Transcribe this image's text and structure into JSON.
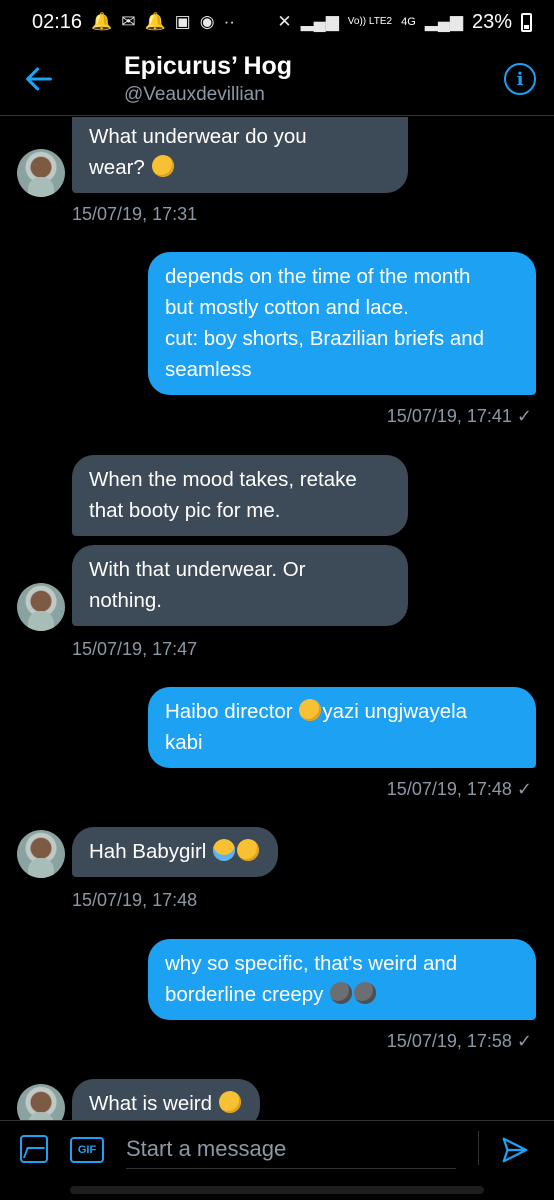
{
  "status_bar": {
    "time": "02:16",
    "left_icons": [
      "bell-icon",
      "gmail-icon",
      "bell-icon",
      "image-icon",
      "wifi-icon",
      "more-icon"
    ],
    "network_label": "Vo)) LTE2",
    "network_type": "4G",
    "battery": "23%"
  },
  "header": {
    "title": "Epicurus’ Hog",
    "handle": "@Veauxdevillian"
  },
  "messages": [
    {
      "dir": "in",
      "text": "What underwear do you wear?",
      "emojis": [
        "thinking-face"
      ]
    },
    {
      "dir": "in-ts",
      "text": "15/07/19, 17:31"
    },
    {
      "dir": "out",
      "text": "depends on the time of the month but mostly cotton and lace. cut: boy shorts, Brazilian briefs and seamless"
    },
    {
      "dir": "out-ts",
      "text": "15/07/19, 17:41 ✓"
    },
    {
      "dir": "in",
      "text": "When the mood takes, retake that booty pic for me."
    },
    {
      "dir": "in",
      "text": "With that underwear. Or nothing."
    },
    {
      "dir": "in-ts",
      "text": "15/07/19, 17:47"
    },
    {
      "dir": "out",
      "text_before": "Haibo director ",
      "text_after": "yazi ungjwayela kabi",
      "emojis": [
        "rolling-laughing-face"
      ]
    },
    {
      "dir": "out-ts",
      "text": "15/07/19, 17:48 ✓"
    },
    {
      "dir": "in",
      "text": "Hah Babygirl",
      "emojis": [
        "loudly-crying-face",
        "weary-face"
      ]
    },
    {
      "dir": "in-ts",
      "text": "15/07/19, 17:48"
    },
    {
      "dir": "out",
      "text": "why so specific, that's weird and borderline creepy",
      "emojis": [
        "new-moon-face",
        "new-moon-face"
      ]
    },
    {
      "dir": "out-ts",
      "text": "15/07/19, 17:58 ✓"
    },
    {
      "dir": "in",
      "text": "What is weird",
      "emojis": [
        "slightly-frowning-face"
      ]
    }
  ],
  "m1": {
    "l1": "What underwear do you",
    "l2": "wear?"
  },
  "m2": {
    "l1": "depends on the time of the month",
    "l2": "but mostly cotton and lace.",
    "l3": "cut: boy shorts, Brazilian briefs and",
    "l4": "seamless"
  },
  "m3": {
    "l1": "When the mood takes, retake",
    "l2": "that booty pic for me."
  },
  "m4": {
    "l1": "With that underwear. Or",
    "l2": "nothing."
  },
  "m5": {
    "l1a": "Haibo director",
    "l1b": "yazi ungjwayela",
    "l2": "kabi"
  },
  "m6": {
    "l1": "Hah Babygirl"
  },
  "m7": {
    "l1": "why so specific, that's weird and",
    "l2": "borderline creepy"
  },
  "m8": {
    "l1": "What is weird"
  },
  "timestamps": {
    "t1": "15/07/19, 17:31",
    "t2": "15/07/19, 17:41 ✓",
    "t3": "15/07/19, 17:47",
    "t4": "15/07/19, 17:48 ✓",
    "t5": "15/07/19, 17:48",
    "t6": "15/07/19, 17:58 ✓"
  },
  "composer": {
    "placeholder": "Start a message",
    "gif_label": "GIF"
  },
  "colors": {
    "background": "#000000",
    "accent": "#1da1f2",
    "incoming_bubble": "#3d4a57",
    "secondary_text": "#8b98a5"
  }
}
